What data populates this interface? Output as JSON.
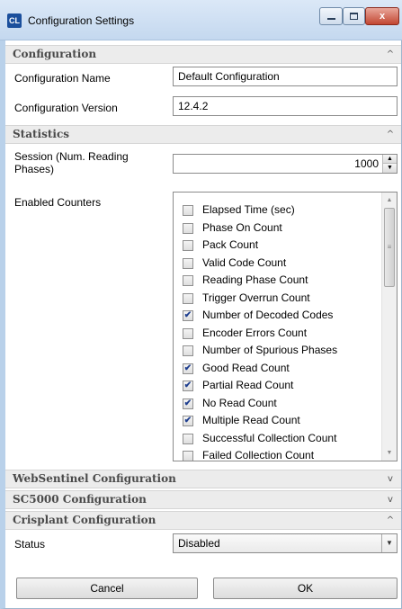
{
  "window": {
    "title": "Configuration Settings",
    "app_icon_text": "CL",
    "min_label": "",
    "max_label": "",
    "close_label": "x"
  },
  "sections": {
    "configuration": {
      "title": "Configuration",
      "chevron": "^"
    },
    "statistics": {
      "title": "Statistics",
      "chevron": "^"
    },
    "websentinel": {
      "title": "WebSentinel Configuration",
      "chevron": "v"
    },
    "sc5000": {
      "title": "SC5000 Configuration",
      "chevron": "v"
    },
    "crisplant": {
      "title": "Crisplant Configuration",
      "chevron": "^"
    }
  },
  "configuration": {
    "name_label": "Configuration Name",
    "name_value": "Default Configuration",
    "version_label": "Configuration Version",
    "version_value": "12.4.2"
  },
  "statistics": {
    "session_label": "Session (Num. Reading Phases)",
    "session_value": "1000",
    "counters_label": "Enabled Counters",
    "counters": [
      {
        "label": "Elapsed Time (sec)",
        "checked": false
      },
      {
        "label": "Phase On Count",
        "checked": false
      },
      {
        "label": "Pack Count",
        "checked": false
      },
      {
        "label": "Valid Code Count",
        "checked": false
      },
      {
        "label": "Reading Phase Count",
        "checked": false
      },
      {
        "label": "Trigger Overrun Count",
        "checked": false
      },
      {
        "label": "Number of Decoded Codes",
        "checked": true
      },
      {
        "label": "Encoder Errors Count",
        "checked": false
      },
      {
        "label": "Number of Spurious Phases",
        "checked": false
      },
      {
        "label": "Good Read Count",
        "checked": true
      },
      {
        "label": "Partial Read Count",
        "checked": true
      },
      {
        "label": "No Read Count",
        "checked": true
      },
      {
        "label": "Multiple Read Count",
        "checked": true
      },
      {
        "label": "Successful Collection Count",
        "checked": false
      },
      {
        "label": "Failed Collection Count",
        "checked": false
      }
    ]
  },
  "crisplant": {
    "status_label": "Status",
    "status_value": "Disabled"
  },
  "footer": {
    "cancel_label": "Cancel",
    "ok_label": "OK"
  }
}
